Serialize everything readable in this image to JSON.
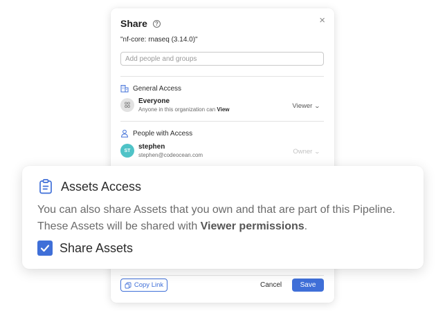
{
  "dialog": {
    "title": "Share",
    "close_label": "×",
    "pipeline_name": "\"nf-core: rnaseq (3.14.0)\"",
    "search": {
      "placeholder": "Add people and groups",
      "value": ""
    },
    "general_access": {
      "heading": "General Access",
      "entry": {
        "name": "Everyone",
        "sub_prefix": "Anyone in this organization can ",
        "sub_bold": "View",
        "role": "Viewer"
      }
    },
    "people_access": {
      "heading": "People with Access",
      "entry": {
        "initials": "ST",
        "name": "stephen",
        "email": "stephen@codeocean.com",
        "role": "Owner"
      }
    },
    "footer": {
      "copy_link_label": "Copy Link",
      "cancel_label": "Cancel",
      "save_label": "Save"
    }
  },
  "assets": {
    "heading": "Assets Access",
    "description_line1": "You can also share Assets that you own and that are part of this Pipeline.",
    "description_line2_prefix": "These Assets will be shared with ",
    "description_line2_bold": "Viewer permissions",
    "description_line2_suffix": ".",
    "checkbox_label": "Share Assets",
    "checkbox_checked": true
  },
  "colors": {
    "accent": "#3f6fd8",
    "user_avatar": "#4fc3c7",
    "group_avatar": "#e2e2e2"
  }
}
